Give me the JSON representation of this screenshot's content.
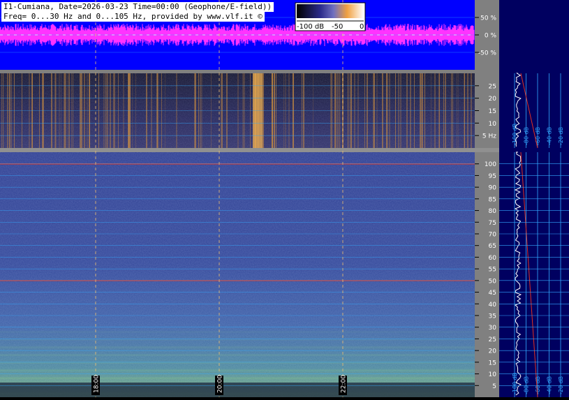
{
  "header": {
    "line1": "I1-Cumiana, Date=2026-03-23 Time=00:00 (Geophone/E-field))",
    "line2": "Freq= 0...30 Hz and 0...105 Hz, provided by www.vlf.it ©"
  },
  "colorbar": {
    "labels": [
      "-100 dB",
      "-50",
      "0"
    ]
  },
  "colors": {
    "waveform_bg": "#0000ff",
    "waveform": "#ff33ff",
    "mains_line": "#e03020",
    "grid": "#33aaff"
  },
  "chart_data": [
    {
      "type": "line",
      "name_in_image": "amplitude waveform",
      "y_ticks": [
        "50 %",
        "0 %",
        "-50 %"
      ],
      "y_values": [
        50,
        0,
        -50
      ],
      "ylim": [
        -100,
        100
      ]
    },
    {
      "type": "heatmap",
      "name_in_image": "spectrogram 0-30 Hz",
      "y_ticks": [
        "25",
        "20",
        "15",
        "10",
        "5 Hz"
      ],
      "y_values": [
        25,
        20,
        15,
        10,
        5
      ],
      "ylim": [
        0,
        30
      ]
    },
    {
      "type": "heatmap",
      "name_in_image": "spectrogram 0-105 Hz",
      "y_ticks": [
        "100",
        "95",
        "90",
        "85",
        "80",
        "75",
        "70",
        "65",
        "60",
        "55",
        "50",
        "45",
        "40",
        "35",
        "30",
        "25",
        "20",
        "15",
        "10",
        "5"
      ],
      "y_values": [
        100,
        95,
        90,
        85,
        80,
        75,
        70,
        65,
        60,
        55,
        50,
        45,
        40,
        35,
        30,
        25,
        20,
        15,
        10,
        5
      ],
      "ylim": [
        0,
        105
      ],
      "horizontal_lines_hz": [
        100,
        50
      ]
    },
    {
      "type": "line",
      "name_in_image": "time axis",
      "x_ticks": [
        "18:00",
        "20:00",
        "22:00"
      ],
      "x_values": [
        18,
        20,
        22
      ]
    },
    {
      "type": "line",
      "name_in_image": "side spectrum panels",
      "db_labels": [
        "-100 dB",
        "-80 dB",
        "-60 dB",
        "-40 dB",
        "-20 dB"
      ]
    }
  ]
}
